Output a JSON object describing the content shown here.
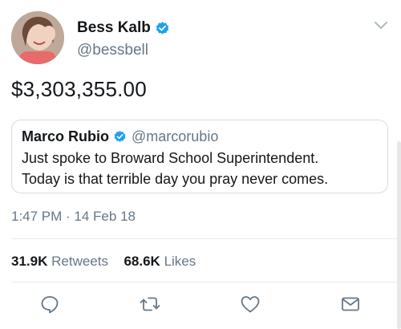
{
  "author": {
    "display_name": "Bess Kalb",
    "handle": "@bessbell",
    "verified": true,
    "avatar_icon": "profile-photo"
  },
  "tweet": {
    "text": "$3,303,355.00",
    "timestamp": "1:47 PM · 14 Feb 18"
  },
  "quoted_tweet": {
    "display_name": "Marco Rubio",
    "handle": "@marcorubio",
    "verified": true,
    "line1": "Just spoke to Broward School Superintendent.",
    "line2": "Today is that terrible day you pray never comes."
  },
  "stats": {
    "retweets_count": "31.9K",
    "retweets_label": "Retweets",
    "likes_count": "68.6K",
    "likes_label": "Likes"
  },
  "actions": [
    "reply-icon",
    "retweet-icon",
    "like-icon",
    "share-dm-icon"
  ],
  "colors": {
    "verified_blue": "#1da1f2",
    "text_primary": "#14171a",
    "text_secondary": "#657786",
    "divider": "#e6ecf0"
  }
}
